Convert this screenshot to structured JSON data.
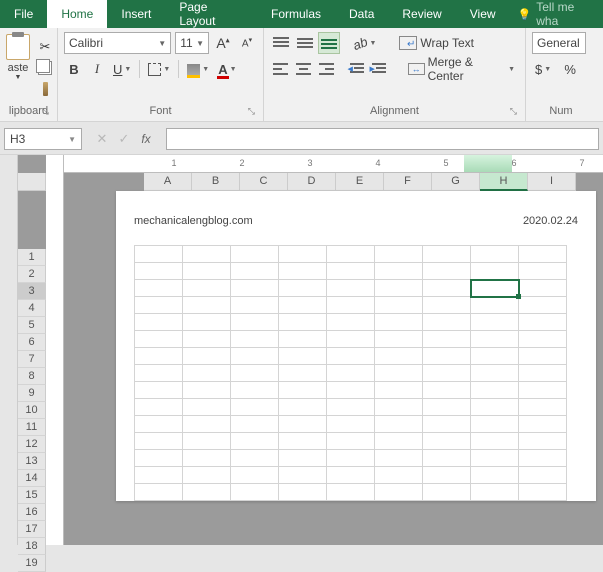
{
  "tabs": {
    "file": "File",
    "home": "Home",
    "insert": "Insert",
    "pagelayout": "Page Layout",
    "formulas": "Formulas",
    "data": "Data",
    "review": "Review",
    "view": "View",
    "tellme": "Tell me wha"
  },
  "ribbon": {
    "clipboard": {
      "label": "lipboard",
      "paste": "aste"
    },
    "font": {
      "label": "Font",
      "name": "Calibri",
      "size": "11"
    },
    "alignment": {
      "label": "Alignment",
      "wrap": "Wrap Text",
      "merge": "Merge & Center"
    },
    "number": {
      "label": "Num",
      "format": "General",
      "currency": "$",
      "percent": "%"
    }
  },
  "formula_bar": {
    "cell_ref": "H3",
    "fx": "fx",
    "value": ""
  },
  "ruler_ticks": [
    "1",
    "2",
    "3",
    "4",
    "5",
    "6",
    "7"
  ],
  "columns": [
    "A",
    "B",
    "C",
    "D",
    "E",
    "F",
    "G",
    "H",
    "I"
  ],
  "rows": [
    "1",
    "2",
    "3",
    "4",
    "5",
    "6",
    "7",
    "8",
    "9",
    "10",
    "11",
    "12",
    "13",
    "14",
    "15",
    "16",
    "17",
    "18",
    "19"
  ],
  "active": {
    "col": "H",
    "row": "3"
  },
  "page": {
    "header_left": "mechanicalengblog.com",
    "header_right": "2020.02.24"
  }
}
